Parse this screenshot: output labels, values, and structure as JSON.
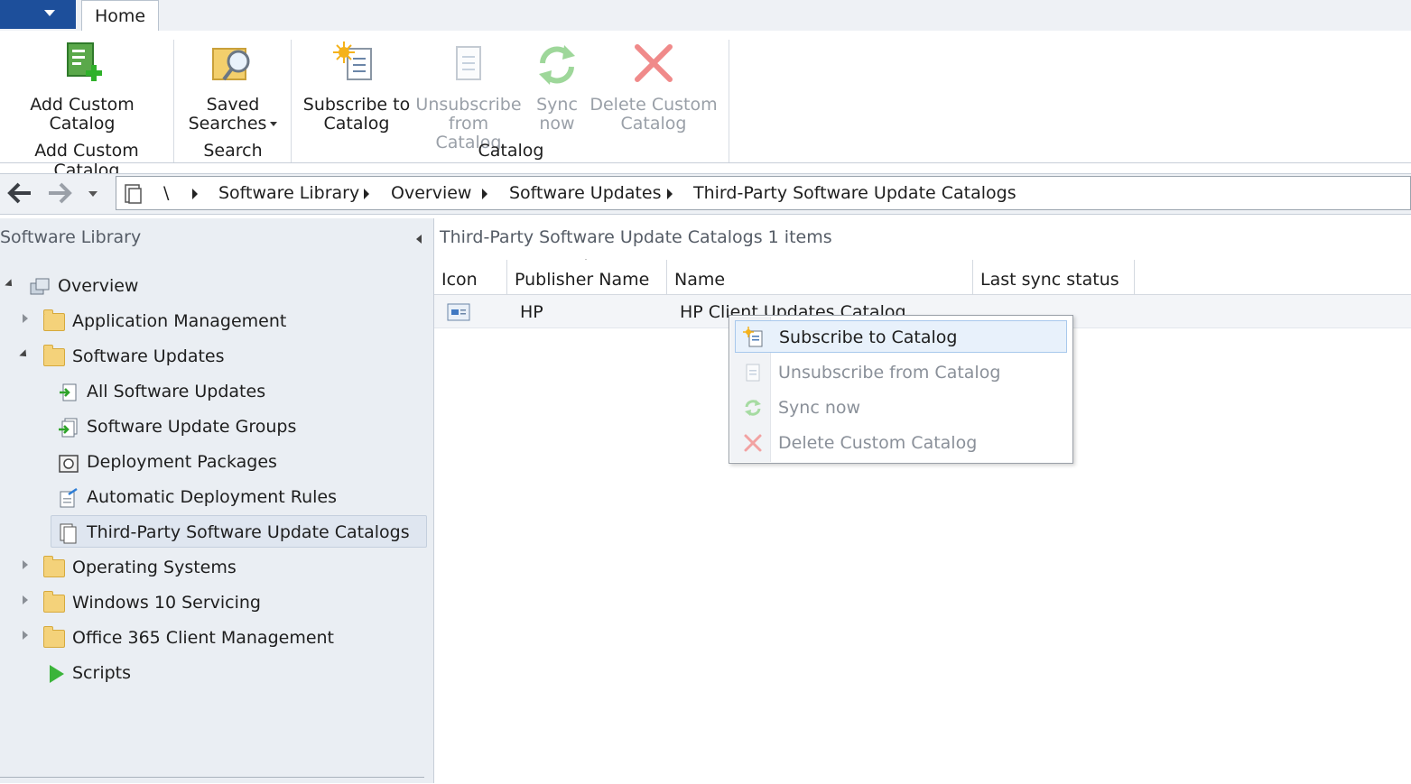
{
  "ribbon": {
    "tab_home": "Home",
    "buttons": {
      "add_custom_catalog": [
        "Add Custom",
        "Catalog"
      ],
      "saved_searches": [
        "Saved",
        "Searches"
      ],
      "subscribe_to_catalog": [
        "Subscribe to",
        "Catalog"
      ],
      "unsubscribe_from_catalog": [
        "Unsubscribe",
        "from Catalog"
      ],
      "sync_now": [
        "Sync",
        "now"
      ],
      "delete_custom_catalog": [
        "Delete Custom",
        "Catalog"
      ]
    },
    "groups": {
      "add_custom_catalog": "Add Custom Catalog",
      "search": "Search",
      "catalog": "Catalog"
    }
  },
  "address": {
    "root": "\\",
    "crumbs": [
      "Software Library",
      "Overview",
      "Software Updates",
      "Third-Party Software Update Catalogs"
    ]
  },
  "nav": {
    "title": "Software Library",
    "items": {
      "overview": "Overview",
      "application_management": "Application Management",
      "software_updates": "Software Updates",
      "all_software_updates": "All Software Updates",
      "software_update_groups": "Software Update Groups",
      "deployment_packages": "Deployment Packages",
      "automatic_deployment_rules": "Automatic Deployment Rules",
      "third_party_catalogs": "Third-Party Software Update Catalogs",
      "operating_systems": "Operating Systems",
      "windows_10_servicing": "Windows 10 Servicing",
      "office_365": "Office 365 Client Management",
      "scripts": "Scripts"
    }
  },
  "main": {
    "title": "Third-Party Software Update Catalogs 1 items",
    "columns": {
      "icon": "Icon",
      "publisher": "Publisher Name",
      "name": "Name",
      "last_sync": "Last sync status"
    },
    "rows": [
      {
        "publisher": "HP",
        "name": "HP Client Updates Catalog",
        "last_sync": ""
      }
    ]
  },
  "context_menu": {
    "subscribe": "Subscribe to Catalog",
    "unsubscribe": "Unsubscribe from Catalog",
    "sync_now": "Sync now",
    "delete": "Delete Custom Catalog"
  },
  "colors": {
    "accent": "#1d4f9b",
    "selection": "#dfe6f0",
    "highlight": "#e8f1fb",
    "disabled_text": "#8a9099"
  }
}
